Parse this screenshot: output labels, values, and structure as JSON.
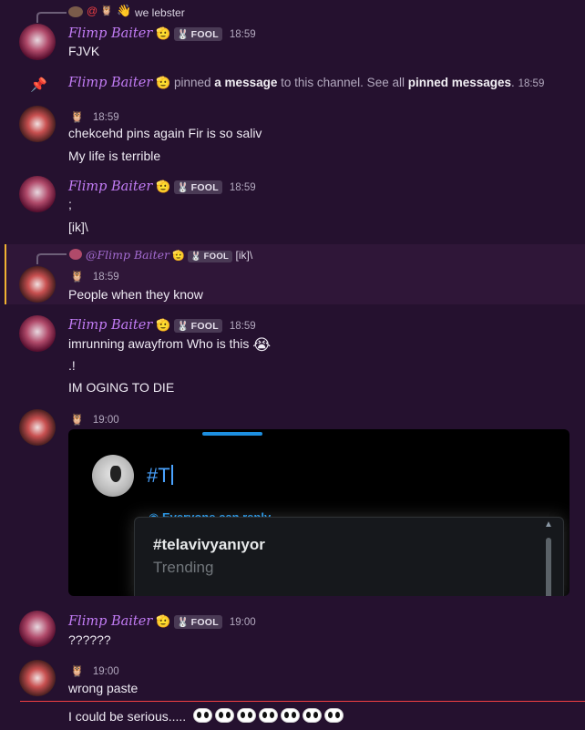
{
  "reply1": {
    "author": "we lebster"
  },
  "m1": {
    "author": "Flimp Baiter",
    "tag": "FOOL",
    "time": "18:59",
    "text": "FJVK"
  },
  "pin": {
    "author": "Flimp Baiter",
    "action": "pinned",
    "link1": "a message",
    "middle": "to this channel. See all",
    "link2": "pinned messages",
    "tail": ".",
    "time": "18:59"
  },
  "m2": {
    "time": "18:59",
    "text1": "chekcehd pins again Fir is so saliv",
    "text2": "My life is terrible"
  },
  "m3": {
    "author": "Flimp Baiter",
    "tag": "FOOL",
    "time": "18:59",
    "text1": ";",
    "text2": "[ik]\\"
  },
  "reply2": {
    "author": "@Flimp Baiter",
    "tag": "FOOL",
    "text": "[ik]\\"
  },
  "m4": {
    "time": "18:59",
    "text": "People when they know"
  },
  "m5": {
    "author": "Flimp Baiter",
    "tag": "FOOL",
    "time": "18:59",
    "text1": "imrunning awayfrom Who is this",
    "text2": ".!",
    "text3": "IM OGING TO DIE"
  },
  "m6": {
    "time": "19:00",
    "embed": {
      "typed": "#T",
      "hint": "Everyone can reply",
      "suggestion": "#telavivyanıyor",
      "sub": "Trending"
    }
  },
  "m7": {
    "author": "Flimp Baiter",
    "tag": "FOOL",
    "time": "19:00",
    "text": "??????"
  },
  "m8": {
    "time": "19:00",
    "text1": "wrong paste",
    "text2": "I could be serious....."
  },
  "colors": {
    "bg": "#25112f",
    "username": "#c27cf5",
    "highlight": "#2f1638",
    "mention_bar": "#f0b232",
    "new_line": "#f23f43"
  }
}
